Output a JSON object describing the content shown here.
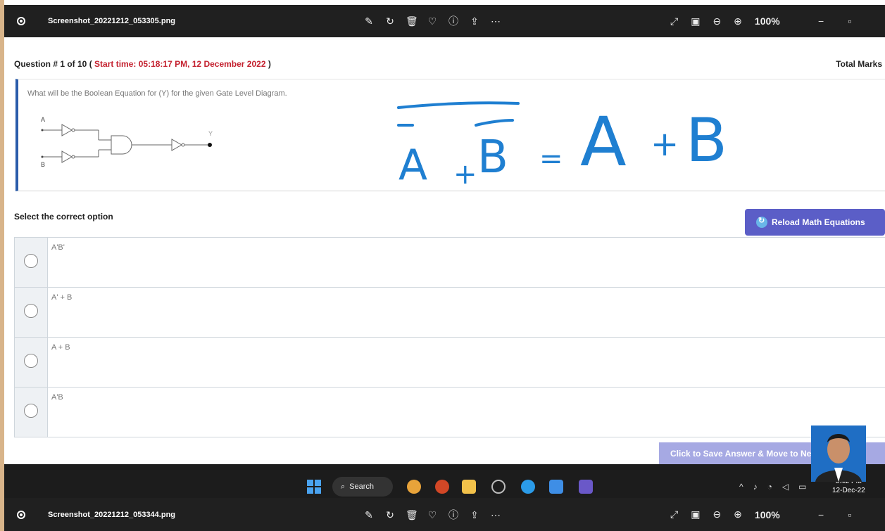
{
  "viewer_top": {
    "filename": "Screenshot_20221212_053305.png",
    "zoom": "100%",
    "icons": [
      "edit-icon",
      "rotate-icon",
      "delete-icon",
      "favorite-icon",
      "info-icon",
      "share-icon",
      "more-icon"
    ],
    "right_icons": [
      "fullscreen-icon",
      "fit-icon",
      "zoom-out-icon",
      "zoom-in-icon"
    ]
  },
  "question": {
    "header_prefix": "Question # 1 of 10 (",
    "start_time": "Start time: 05:18:17 PM, 12 December 2022",
    "header_suffix": ")",
    "total_marks": "Total Marks",
    "text": "What will be the Boolean Equation for (Y) for the given Gate Level Diagram.",
    "gate_labels": {
      "a": "A",
      "b": "B",
      "y": "Y"
    },
    "ink": {
      "lhs_a": "A",
      "lhs_b": "B",
      "plus": "+",
      "equals": "=",
      "rhs_a": "A",
      "rhs_plus": "+",
      "rhs_b": "B"
    }
  },
  "select_label": "Select the correct option",
  "reload_label": "Reload Math Equations",
  "options": [
    {
      "text": "A'B'"
    },
    {
      "text": "A' + B"
    },
    {
      "text": "A + B"
    },
    {
      "text": "A'B"
    }
  ],
  "save_label": "Click to Save Answer & Move to Next Question",
  "taskbar": {
    "search_label": "Search",
    "time": "5:42 PM",
    "date": "12-Dec-22"
  },
  "viewer_bottom": {
    "filename": "Screenshot_20221212_053344.png",
    "zoom": "100%"
  },
  "colors": {
    "accent": "#5b5ec7",
    "start_time": "#c4212f",
    "ink": "#1f7fd1"
  }
}
